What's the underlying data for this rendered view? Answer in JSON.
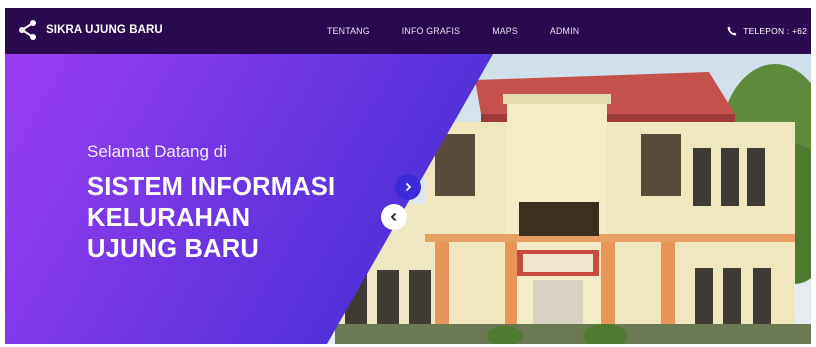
{
  "navbar": {
    "brand_name": "SIKRA UJUNG BARU",
    "brand_icon": "share-nodes-icon",
    "menu": [
      {
        "label": "TENTANG"
      },
      {
        "label": "INFO GRAFIS"
      },
      {
        "label": "MAPS"
      },
      {
        "label": "ADMIN"
      }
    ],
    "phone_icon": "phone-icon",
    "phone_label": "TELEPON : +62"
  },
  "hero": {
    "welcome": "Selamat Datang di",
    "title_lines": [
      "SISTEM INFORMASI",
      "KELURAHAN",
      "UJUNG BARU"
    ],
    "next_icon": "chevron-right-icon",
    "prev_icon": "chevron-left-icon"
  },
  "colors": {
    "navbar_bg": "#2a0a4e",
    "overlay_start": "#9b3df2",
    "overlay_end": "#4b2fd6",
    "next_button": "#3b2ad9"
  }
}
